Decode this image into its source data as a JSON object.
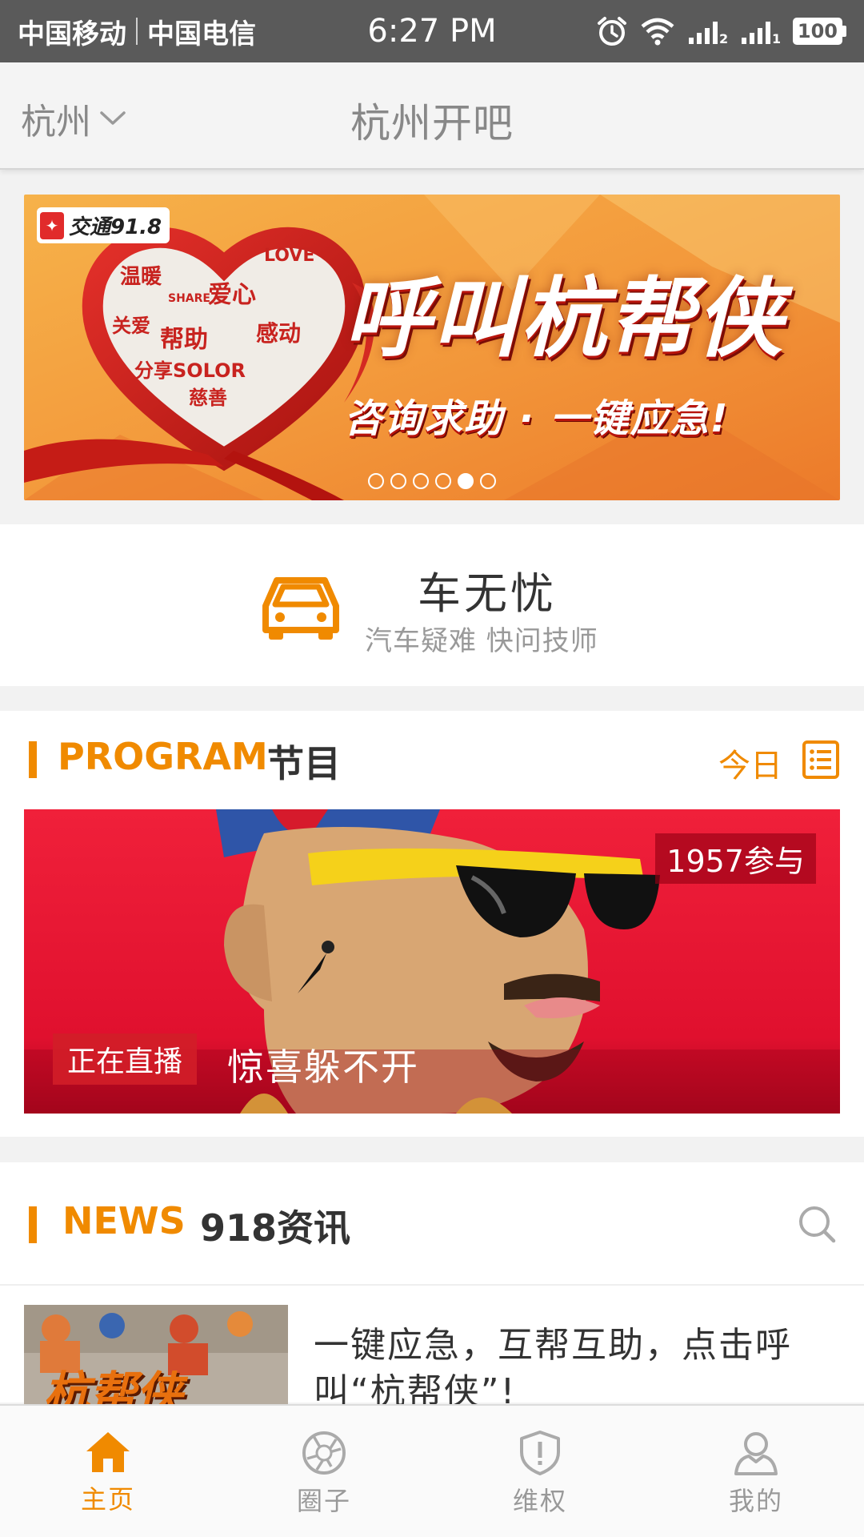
{
  "status_bar": {
    "carrier1": "中国移动",
    "carrier2": "中国电信",
    "time": "6:27 PM",
    "battery": "100"
  },
  "header": {
    "city": "杭州",
    "title": "杭州开吧"
  },
  "banner": {
    "logo_text": "交通91.8",
    "headline": "呼叫杭帮侠",
    "subline": "咨询求助 · 一键应急!",
    "heart_words": [
      "温暖",
      "爱心",
      "帮助",
      "感动",
      "关爱",
      "分享SOLOR",
      "慈善",
      "LOVE",
      "SHARE"
    ],
    "page_count": 6,
    "active_index": 4
  },
  "car_service": {
    "title": "车无忧",
    "subtitle": "汽车疑难 快问技师",
    "icon": "car-icon"
  },
  "program": {
    "label_en": "PROGRAM",
    "label_cn": "节目",
    "today_label": "今日",
    "participants": "1957参与",
    "live_badge": "正在直播",
    "show_title": "惊喜躲不开"
  },
  "news": {
    "label_en": "NEWS",
    "label_cn": "918资讯",
    "items": [
      {
        "title": "一键应急，互帮互助，点击呼叫“杭帮侠”!",
        "thumb_text": "杭帮侠"
      }
    ]
  },
  "tabs": [
    {
      "label": "主页",
      "icon": "home-icon",
      "active": true
    },
    {
      "label": "圈子",
      "icon": "aperture-icon",
      "active": false
    },
    {
      "label": "维权",
      "icon": "shield-icon",
      "active": false
    },
    {
      "label": "我的",
      "icon": "user-icon",
      "active": false
    }
  ],
  "colors": {
    "accent": "#f08a00",
    "status_bar": "#5a5a5a",
    "live_red": "#d21e28"
  }
}
